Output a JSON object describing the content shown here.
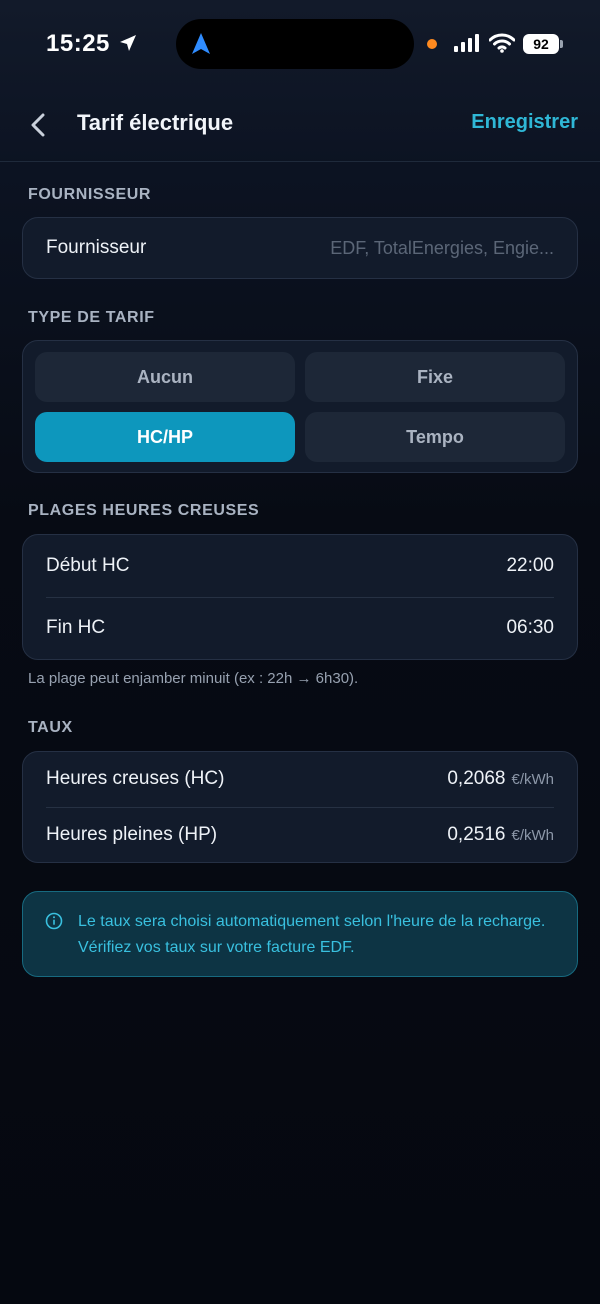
{
  "status": {
    "time": "15:25",
    "battery": "92"
  },
  "header": {
    "title": "Tarif électrique",
    "save_label": "Enregistrer"
  },
  "provider": {
    "section_label": "FOURNISSEUR",
    "field_label": "Fournisseur",
    "placeholder": "EDF, TotalEnergies, Engie..."
  },
  "tariff_type": {
    "section_label": "TYPE DE TARIF",
    "options": [
      {
        "label": "Aucun",
        "selected": false
      },
      {
        "label": "Fixe",
        "selected": false
      },
      {
        "label": "HC/HP",
        "selected": true
      },
      {
        "label": "Tempo",
        "selected": false
      }
    ]
  },
  "off_peak": {
    "section_label": "PLAGES HEURES CREUSES",
    "start_label": "Début HC",
    "start_value": "22:00",
    "end_label": "Fin HC",
    "end_value": "06:30",
    "hint": "La plage peut enjamber minuit (ex : 22h → 6h30)."
  },
  "rates": {
    "section_label": "TAUX",
    "hc_label": "Heures creuses (HC)",
    "hc_value": "0,2068",
    "hp_label": "Heures pleines (HP)",
    "hp_value": "0,2516",
    "unit": "€/kWh"
  },
  "info": {
    "text": "Le taux sera choisi automatiquement selon l'heure de la recharge. Vérifiez vos taux sur votre facture EDF."
  },
  "colors": {
    "accent": "#2fb7d6",
    "selected_segment": "#0d97bd",
    "background": "#070b14",
    "card": "#121b2b"
  }
}
